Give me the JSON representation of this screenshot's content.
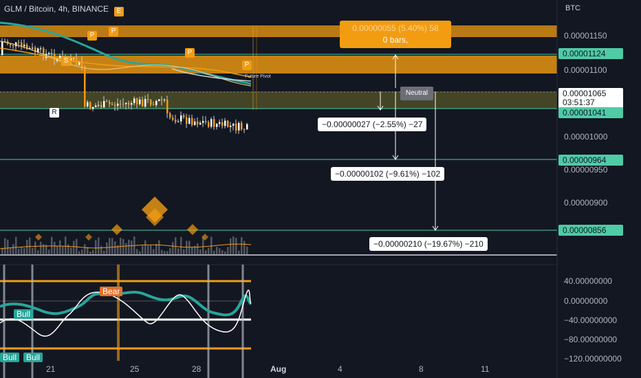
{
  "header": {
    "symbol_title": "GLM / Bitcoin, 4h, BINANCE",
    "currency": "BTC"
  },
  "price_axis": {
    "ticks": [
      "0.00001150",
      "0.00001100",
      "0.00001000",
      "0.00000950",
      "0.00000900"
    ],
    "tags": {
      "level_upper": "0.00001124",
      "current_price": "0.00001065",
      "countdown": "03:51:37",
      "level_lower": "0.00001041",
      "support_1": "0.00000964",
      "support_2": "0.00000856"
    }
  },
  "oscillator_axis": {
    "ticks": [
      "40.00000000",
      "0.00000000",
      "−40.00000000",
      "−80.00000000",
      "−120.00000000"
    ]
  },
  "time_axis": {
    "ticks": [
      "21",
      "25",
      "28",
      "Aug",
      "4",
      "8",
      "11"
    ]
  },
  "drawings": {
    "range_label_line1": "0.00000055 (5.40%) 58",
    "range_label_line2": "0 bars,",
    "neutral_label": "Neutral",
    "future_pivot_label": "Future Pivot",
    "measure_1": "−0.00000027 (−2.55%) −27",
    "measure_2": "−0.00000102 (−9.61%) −102",
    "measure_3": "−0.00000210 (−19.67%) −210"
  },
  "markers": {
    "pivot_letter": "P",
    "r_letter": "R",
    "s_letter": "S",
    "e_letter": "E"
  },
  "oscillator": {
    "bear_label": "Bear",
    "bull_label": "Bull"
  },
  "colors": {
    "background": "#131722",
    "orange": "#f29c12",
    "teal": "#4fcba6",
    "green_line": "#26a69a",
    "bull_badge": "#26a69a",
    "bear_badge": "#e0712c"
  }
}
